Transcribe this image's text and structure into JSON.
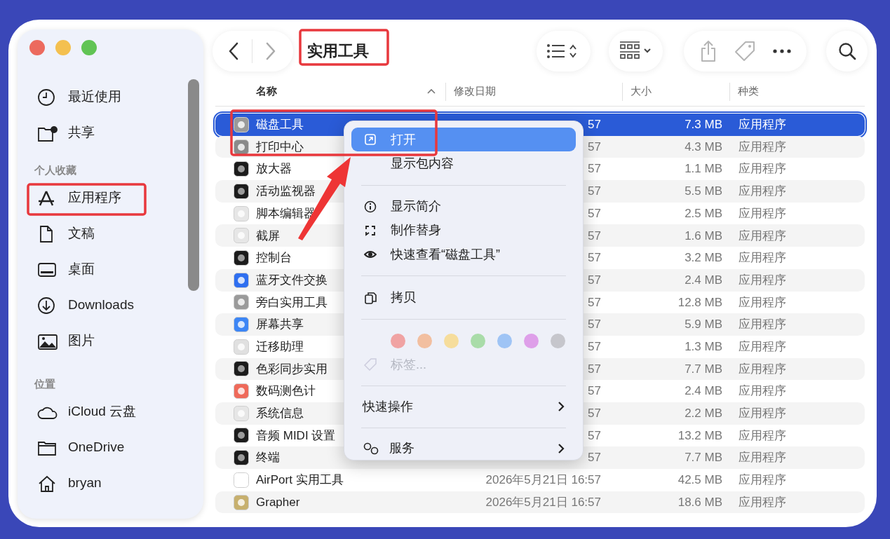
{
  "window": {
    "title": "实用工具"
  },
  "sidebar": {
    "sections": [
      {
        "items": [
          {
            "label": "最近使用"
          },
          {
            "label": "共享"
          }
        ]
      },
      {
        "heading": "个人收藏",
        "items": [
          {
            "label": "应用程序"
          },
          {
            "label": "文稿"
          },
          {
            "label": "桌面"
          },
          {
            "label": "Downloads"
          },
          {
            "label": "图片"
          }
        ]
      },
      {
        "heading": "位置",
        "items": [
          {
            "label": "iCloud 云盘"
          },
          {
            "label": "OneDrive"
          },
          {
            "label": "bryan"
          }
        ]
      }
    ]
  },
  "table": {
    "columns": [
      {
        "label": "名称",
        "sorted": true
      },
      {
        "label": "修改日期",
        "sorted": false
      },
      {
        "label": "大小",
        "sorted": false
      },
      {
        "label": "种类",
        "sorted": false
      }
    ],
    "rows": [
      {
        "name": "磁盘工具",
        "date": "57",
        "size": "7.3 MB",
        "kind": "应用程序",
        "selected": true
      },
      {
        "name": "打印中心",
        "date": "57",
        "size": "4.3 MB",
        "kind": "应用程序",
        "selected": false
      },
      {
        "name": "放大器",
        "date": "57",
        "size": "1.1 MB",
        "kind": "应用程序",
        "selected": false
      },
      {
        "name": "活动监视器",
        "date": "57",
        "size": "5.5 MB",
        "kind": "应用程序",
        "selected": false
      },
      {
        "name": "脚本编辑器",
        "date": "57",
        "size": "2.5 MB",
        "kind": "应用程序",
        "selected": false
      },
      {
        "name": "截屏",
        "date": "57",
        "size": "1.6 MB",
        "kind": "应用程序",
        "selected": false
      },
      {
        "name": "控制台",
        "date": "57",
        "size": "3.2 MB",
        "kind": "应用程序",
        "selected": false
      },
      {
        "name": "蓝牙文件交换",
        "date": "57",
        "size": "2.4 MB",
        "kind": "应用程序",
        "selected": false
      },
      {
        "name": "旁白实用工具",
        "date": "57",
        "size": "12.8 MB",
        "kind": "应用程序",
        "selected": false
      },
      {
        "name": "屏幕共享",
        "date": "57",
        "size": "5.9 MB",
        "kind": "应用程序",
        "selected": false
      },
      {
        "name": "迁移助理",
        "date": "57",
        "size": "1.3 MB",
        "kind": "应用程序",
        "selected": false
      },
      {
        "name": "色彩同步实用",
        "date": "57",
        "size": "7.7 MB",
        "kind": "应用程序",
        "selected": false
      },
      {
        "name": "数码测色计",
        "date": "57",
        "size": "2.4 MB",
        "kind": "应用程序",
        "selected": false
      },
      {
        "name": "系统信息",
        "date": "57",
        "size": "2.2 MB",
        "kind": "应用程序",
        "selected": false
      },
      {
        "name": "音频 MIDI 设置",
        "date": "57",
        "size": "13.2 MB",
        "kind": "应用程序",
        "selected": false
      },
      {
        "name": "终端",
        "date": "57",
        "size": "7.7 MB",
        "kind": "应用程序",
        "selected": false
      },
      {
        "name": "AirPort 实用工具",
        "date": "2026年5月21日 16:57",
        "size": "42.5 MB",
        "kind": "应用程序",
        "selected": false
      },
      {
        "name": "Grapher",
        "date": "2026年5月21日 16:57",
        "size": "18.6 MB",
        "kind": "应用程序",
        "selected": false
      }
    ]
  },
  "context_menu": {
    "items": [
      {
        "kind": "item",
        "label": "打开",
        "selected": true,
        "disabled": false
      },
      {
        "kind": "item",
        "label": "显示包内容",
        "selected": false,
        "disabled": false
      },
      {
        "kind": "separator"
      },
      {
        "kind": "item",
        "label": "显示简介",
        "selected": false,
        "disabled": false
      },
      {
        "kind": "item",
        "label": "制作替身",
        "selected": false,
        "disabled": false
      },
      {
        "kind": "item",
        "label": "快速查看“磁盘工具”",
        "selected": false,
        "disabled": false
      },
      {
        "kind": "separator"
      },
      {
        "kind": "item",
        "label": "拷贝",
        "selected": false,
        "disabled": false
      },
      {
        "kind": "separator"
      },
      {
        "kind": "colors",
        "colors": [
          {
            "color": "#f0a3a3"
          },
          {
            "color": "#f2bfa0"
          },
          {
            "color": "#f6dd9c"
          },
          {
            "color": "#a9dca9"
          },
          {
            "color": "#9fc4f5"
          },
          {
            "color": "#de9fe9"
          },
          {
            "color": "#c6c6cc"
          }
        ]
      },
      {
        "kind": "item",
        "label": "标签...",
        "selected": false,
        "disabled": true
      },
      {
        "kind": "separator"
      },
      {
        "kind": "submenu",
        "label": "快速操作"
      },
      {
        "kind": "separator"
      },
      {
        "kind": "submenu",
        "label": "服务"
      }
    ]
  },
  "annotations": [
    {
      "kind": "frame"
    },
    {
      "kind": "frame"
    },
    {
      "kind": "frame"
    },
    {
      "kind": "arrow"
    }
  ]
}
